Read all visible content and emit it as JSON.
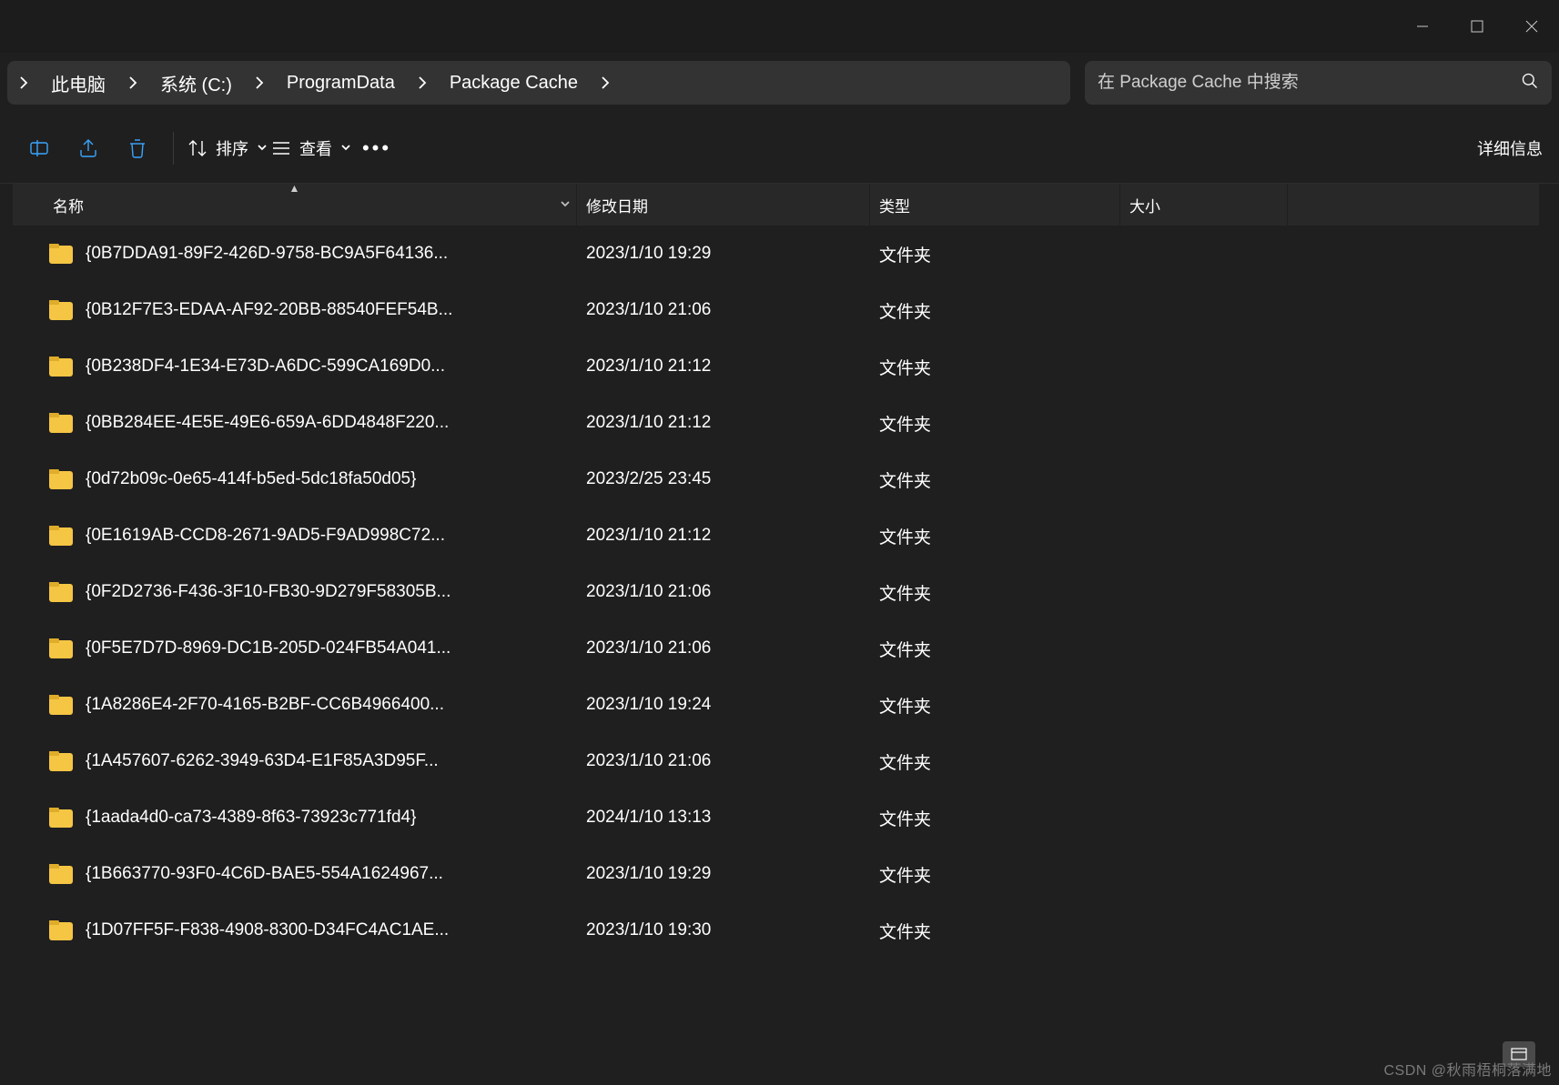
{
  "search": {
    "placeholder": "在 Package Cache 中搜索"
  },
  "breadcrumb": {
    "items": [
      "此电脑",
      "系统 (C:)",
      "ProgramData",
      "Package Cache"
    ]
  },
  "toolbar": {
    "sort_label": "排序",
    "view_label": "查看",
    "details_label": "详细信息"
  },
  "columns": {
    "name": "名称",
    "date": "修改日期",
    "type": "类型",
    "size": "大小"
  },
  "items": [
    {
      "name": "{0B7DDA91-89F2-426D-9758-BC9A5F64136...",
      "date": "2023/1/10 19:29",
      "type": "文件夹",
      "size": ""
    },
    {
      "name": "{0B12F7E3-EDAA-AF92-20BB-88540FEF54B...",
      "date": "2023/1/10 21:06",
      "type": "文件夹",
      "size": ""
    },
    {
      "name": "{0B238DF4-1E34-E73D-A6DC-599CA169D0...",
      "date": "2023/1/10 21:12",
      "type": "文件夹",
      "size": ""
    },
    {
      "name": "{0BB284EE-4E5E-49E6-659A-6DD4848F220...",
      "date": "2023/1/10 21:12",
      "type": "文件夹",
      "size": ""
    },
    {
      "name": "{0d72b09c-0e65-414f-b5ed-5dc18fa50d05}",
      "date": "2023/2/25 23:45",
      "type": "文件夹",
      "size": ""
    },
    {
      "name": "{0E1619AB-CCD8-2671-9AD5-F9AD998C72...",
      "date": "2023/1/10 21:12",
      "type": "文件夹",
      "size": ""
    },
    {
      "name": "{0F2D2736-F436-3F10-FB30-9D279F58305B...",
      "date": "2023/1/10 21:06",
      "type": "文件夹",
      "size": ""
    },
    {
      "name": "{0F5E7D7D-8969-DC1B-205D-024FB54A041...",
      "date": "2023/1/10 21:06",
      "type": "文件夹",
      "size": ""
    },
    {
      "name": "{1A8286E4-2F70-4165-B2BF-CC6B4966400...",
      "date": "2023/1/10 19:24",
      "type": "文件夹",
      "size": ""
    },
    {
      "name": "{1A457607-6262-3949-63D4-E1F85A3D95F...",
      "date": "2023/1/10 21:06",
      "type": "文件夹",
      "size": ""
    },
    {
      "name": "{1aada4d0-ca73-4389-8f63-73923c771fd4}",
      "date": "2024/1/10 13:13",
      "type": "文件夹",
      "size": ""
    },
    {
      "name": "{1B663770-93F0-4C6D-BAE5-554A1624967...",
      "date": "2023/1/10 19:29",
      "type": "文件夹",
      "size": ""
    },
    {
      "name": "{1D07FF5F-F838-4908-8300-D34FC4AC1AE...",
      "date": "2023/1/10 19:30",
      "type": "文件夹",
      "size": ""
    }
  ],
  "watermark": "CSDN @秋雨梧桐落满地"
}
